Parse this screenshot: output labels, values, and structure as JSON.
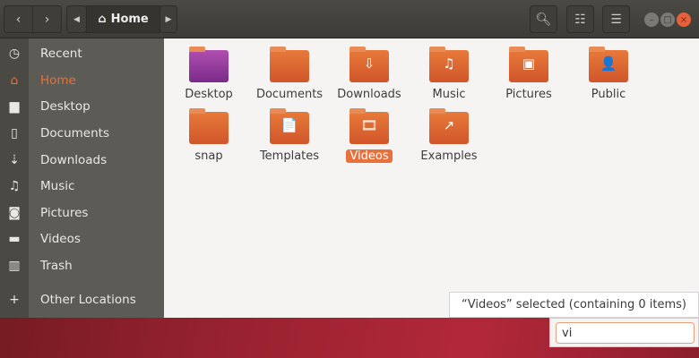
{
  "header": {
    "breadcrumb": "Home",
    "home_icon": "⌂"
  },
  "sidebar": {
    "items": [
      {
        "label": "Recent",
        "icon": "◷"
      },
      {
        "label": "Home",
        "icon": "⌂"
      },
      {
        "label": "Desktop",
        "icon": "▆"
      },
      {
        "label": "Documents",
        "icon": "▯"
      },
      {
        "label": "Downloads",
        "icon": "⇣"
      },
      {
        "label": "Music",
        "icon": "♫"
      },
      {
        "label": "Pictures",
        "icon": "◙"
      },
      {
        "label": "Videos",
        "icon": "▬"
      },
      {
        "label": "Trash",
        "icon": "▥"
      },
      {
        "label": "Other Locations",
        "icon": "+"
      }
    ]
  },
  "files": [
    {
      "label": "Desktop",
      "glyph": ""
    },
    {
      "label": "Documents",
      "glyph": ""
    },
    {
      "label": "Downloads",
      "glyph": "⇩"
    },
    {
      "label": "Music",
      "glyph": "♫"
    },
    {
      "label": "Pictures",
      "glyph": "▣"
    },
    {
      "label": "Public",
      "glyph": "👤"
    },
    {
      "label": "snap",
      "glyph": ""
    },
    {
      "label": "Templates",
      "glyph": "📄"
    },
    {
      "label": "Videos",
      "glyph": "🎞"
    },
    {
      "label": "Examples",
      "glyph": "↗"
    }
  ],
  "status": "“Videos” selected  (containing 0 items)",
  "search": {
    "value": "vi"
  },
  "colors": {
    "accent": "#e8703a",
    "header": "#3d3c37",
    "sidebar": "#5c5b55"
  }
}
